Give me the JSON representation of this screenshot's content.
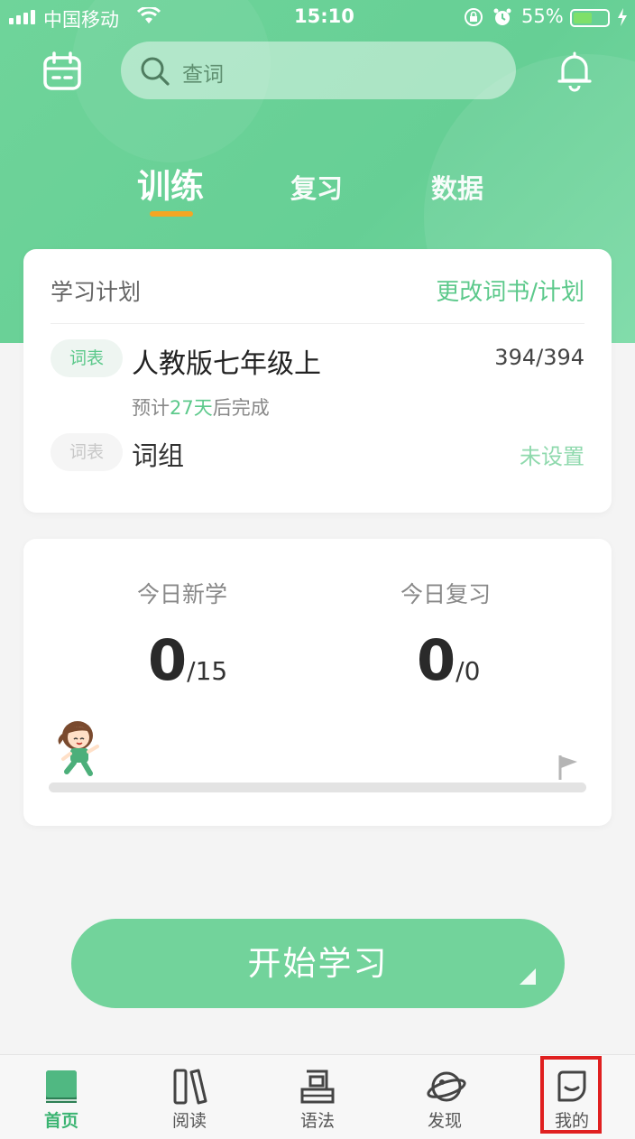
{
  "status_bar": {
    "carrier": "中国移动",
    "time": "15:10",
    "battery_percent": "55%",
    "battery_level": 0.55
  },
  "header": {
    "search_placeholder": "查词"
  },
  "tabs": [
    {
      "label": "训练",
      "active": true
    },
    {
      "label": "复习",
      "active": false
    },
    {
      "label": "数据",
      "active": false
    }
  ],
  "plan": {
    "title": "学习计划",
    "change_link": "更改词书/计划",
    "book": {
      "tag": "词表",
      "name": "人教版七年级上",
      "progress": "394/394",
      "estimate_prefix": "预计",
      "estimate_days": "27天",
      "estimate_suffix": "后完成"
    },
    "group": {
      "tag": "词表",
      "name": "词组",
      "status": "未设置"
    }
  },
  "today": {
    "new_label": "今日新学",
    "new_done": "0",
    "new_total": "/15",
    "review_label": "今日复习",
    "review_done": "0",
    "review_total": "/0",
    "progress_fraction": 0
  },
  "start_button": "开始学习",
  "tabbar": [
    {
      "label": "首页",
      "icon": "book-icon",
      "active": true
    },
    {
      "label": "阅读",
      "icon": "books-icon",
      "active": false
    },
    {
      "label": "语法",
      "icon": "grammar-icon",
      "active": false
    },
    {
      "label": "发现",
      "icon": "planet-icon",
      "active": false
    },
    {
      "label": "我的",
      "icon": "profile-icon",
      "active": false
    }
  ],
  "colors": {
    "brand_green": "#66cf95",
    "accent_orange": "#f5a623",
    "highlight_red": "#e02020"
  }
}
